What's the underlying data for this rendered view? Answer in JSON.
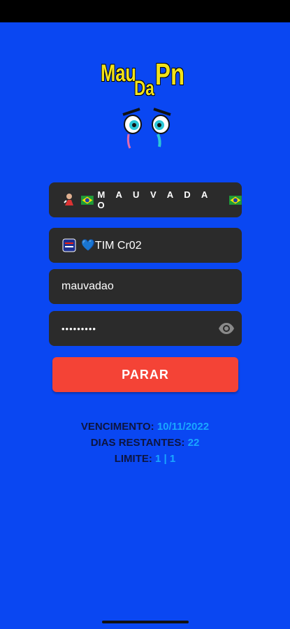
{
  "logo": {
    "line1": "Mau",
    "line2": "Da",
    "line3": "Pn"
  },
  "fields": {
    "user_label": "M A U V A D A O",
    "server_label": "💙TIM Cr02",
    "username_value": "mauvadao",
    "password_value": "•••••••••"
  },
  "button": {
    "label": "PARAR"
  },
  "info": {
    "vencimento_label": "VENCIMENTO:",
    "vencimento_value": "10/11/2022",
    "dias_label": "DIAS RESTANTES:",
    "dias_value": "22",
    "limite_label": "LIMITE:",
    "limite_value": "1 | 1"
  },
  "colors": {
    "background": "#0a47f2",
    "button": "#f44336",
    "field": "#2b2b2b",
    "info_value": "#19a7ff"
  }
}
